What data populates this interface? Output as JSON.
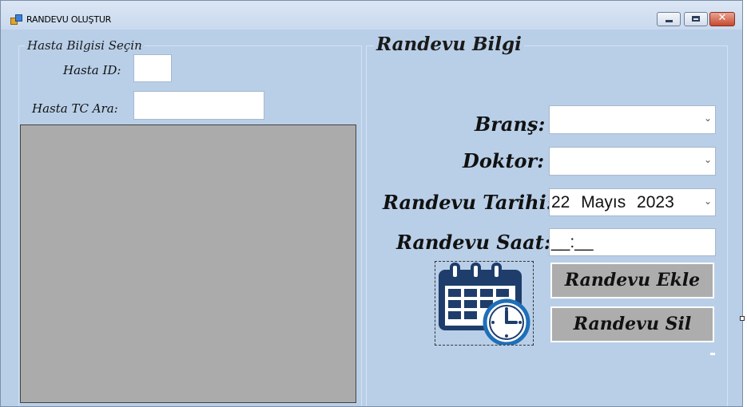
{
  "window": {
    "title": "RANDEVU OLUŞTUR"
  },
  "patient_group": {
    "legend": "Hasta Bilgisi Seçin",
    "hasta_id_label": "Hasta ID:",
    "hasta_id_value": "",
    "hasta_tc_label": "Hasta TC Ara:",
    "hasta_tc_value": ""
  },
  "appointment_group": {
    "legend": "Randevu Bilgi",
    "brans_label": "Branş:",
    "brans_value": "",
    "doktor_label": "Doktor:",
    "doktor_value": "",
    "tarih_label": "Randevu Tarihi:",
    "tarih_value": "22  Mayıs  2023",
    "saat_label": "Randevu Saat:",
    "saat_value": "__:__",
    "add_button": "Randevu Ekle",
    "delete_button": "Randevu Sil"
  },
  "colors": {
    "form_bg": "#b9cfe8",
    "button_bg": "#adadad",
    "grid_bg": "#ababab",
    "icon": "#1e3d6b"
  },
  "icons": [
    "application-icon",
    "minimize-icon",
    "maximize-icon",
    "close-icon",
    "dropdown-chevron-icon",
    "calendar-clock-icon"
  ]
}
